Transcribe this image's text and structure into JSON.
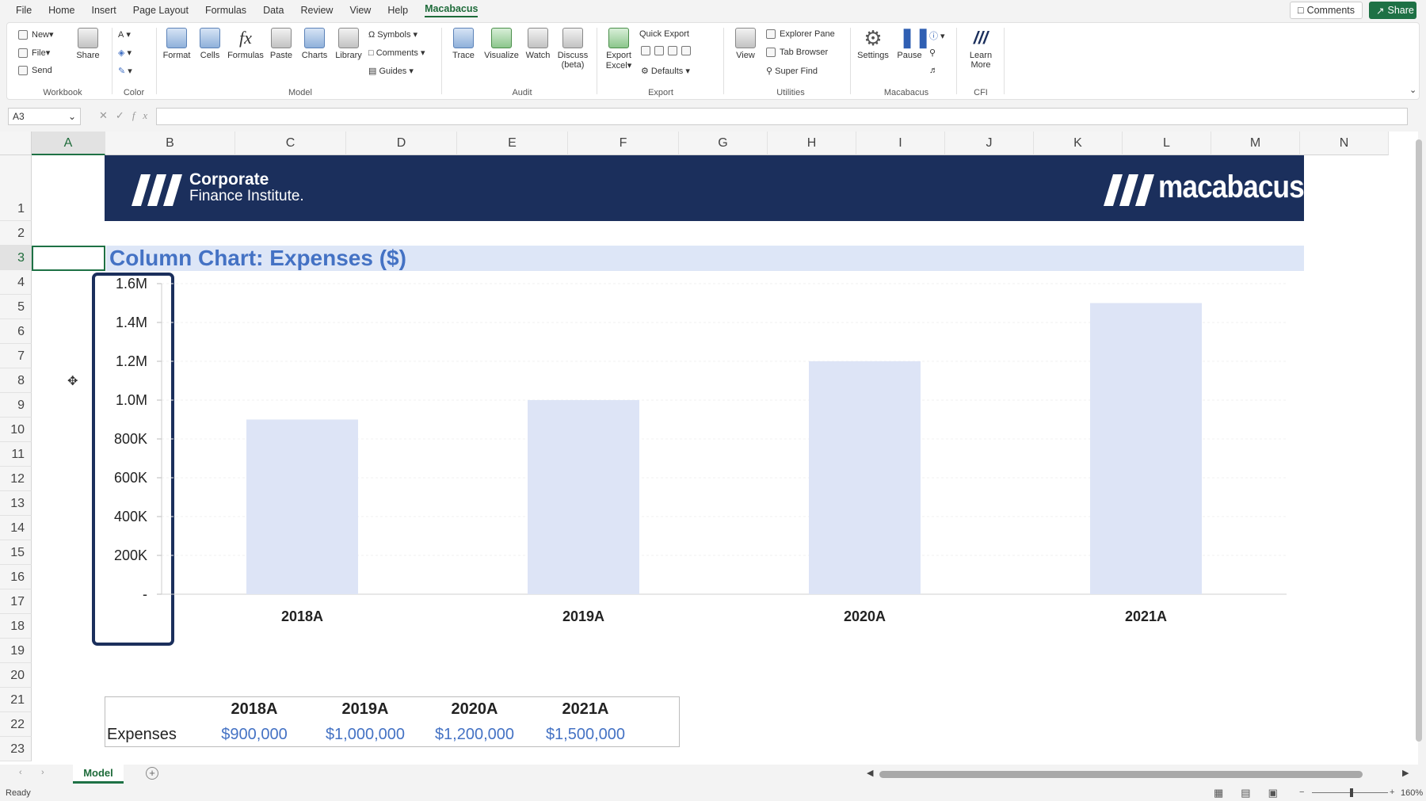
{
  "menu": {
    "tabs": [
      "File",
      "Home",
      "Insert",
      "Page Layout",
      "Formulas",
      "Data",
      "Review",
      "View",
      "Help",
      "Macabacus"
    ],
    "active_tab": "Macabacus",
    "comments_label": "Comments",
    "share_label": "Share"
  },
  "ribbon": {
    "workbook": {
      "new": "New",
      "file": "File",
      "send": "Send",
      "share": "Share",
      "group": "Workbook"
    },
    "color": {
      "group": "Color"
    },
    "model": {
      "format": "Format",
      "cells": "Cells",
      "formulas": "Formulas",
      "paste": "Paste",
      "charts": "Charts",
      "library": "Library",
      "symbols": "Symbols",
      "comments": "Comments",
      "guides": "Guides",
      "group": "Model"
    },
    "audit": {
      "trace": "Trace",
      "visualize": "Visualize",
      "watch": "Watch",
      "discuss": "Discuss",
      "discuss2": "(beta)",
      "group": "Audit"
    },
    "export": {
      "export_excel": "Export",
      "export_excel2": "Excel",
      "quick_export": "Quick Export",
      "defaults": "Defaults",
      "group": "Export"
    },
    "utilities": {
      "view": "View",
      "explorer": "Explorer Pane",
      "tab_browser": "Tab Browser",
      "super_find": "Super Find",
      "group": "Utilities"
    },
    "macabacus": {
      "settings": "Settings",
      "pause": "Pause",
      "group": "Macabacus"
    },
    "cfi": {
      "learn": "Learn",
      "learn2": "More",
      "group": "CFI"
    }
  },
  "formula_bar": {
    "name_box": "A3",
    "fx": "fx",
    "value": ""
  },
  "columns": [
    "A",
    "B",
    "C",
    "D",
    "E",
    "F",
    "G",
    "H",
    "I",
    "J",
    "K",
    "L",
    "M",
    "N"
  ],
  "rows": [
    "1",
    "2",
    "3",
    "4",
    "5",
    "6",
    "7",
    "8",
    "9",
    "10",
    "11",
    "12",
    "13",
    "14",
    "15",
    "16",
    "17",
    "18",
    "19",
    "20",
    "21",
    "22",
    "23"
  ],
  "banner": {
    "cfi_line1": "Corporate",
    "cfi_line2": "Finance Institute.",
    "macabacus": "macabacus"
  },
  "sheet_title": "Column Chart: Expenses ($)",
  "chart_data": {
    "type": "bar",
    "title": "",
    "categories": [
      "2018A",
      "2019A",
      "2020A",
      "2021A"
    ],
    "series": [
      {
        "values": [
          900000,
          1000000,
          1200000,
          1500000
        ]
      }
    ],
    "ylim": [
      0,
      1600000
    ],
    "y_ticks": [
      "1.6M",
      "1.4M",
      "1.2M",
      "1.0M",
      "800K",
      "600K",
      "400K",
      "200K",
      "-"
    ],
    "grid": true,
    "bar_color": "#dde4f6"
  },
  "table": {
    "headers": [
      "",
      "2018A",
      "2019A",
      "2020A",
      "2021A"
    ],
    "row_label": "Expenses",
    "values": [
      "$900,000",
      "$1,000,000",
      "$1,200,000",
      "$1,500,000"
    ]
  },
  "sheet_tab": "Model",
  "status": "Ready",
  "zoom": "160%"
}
